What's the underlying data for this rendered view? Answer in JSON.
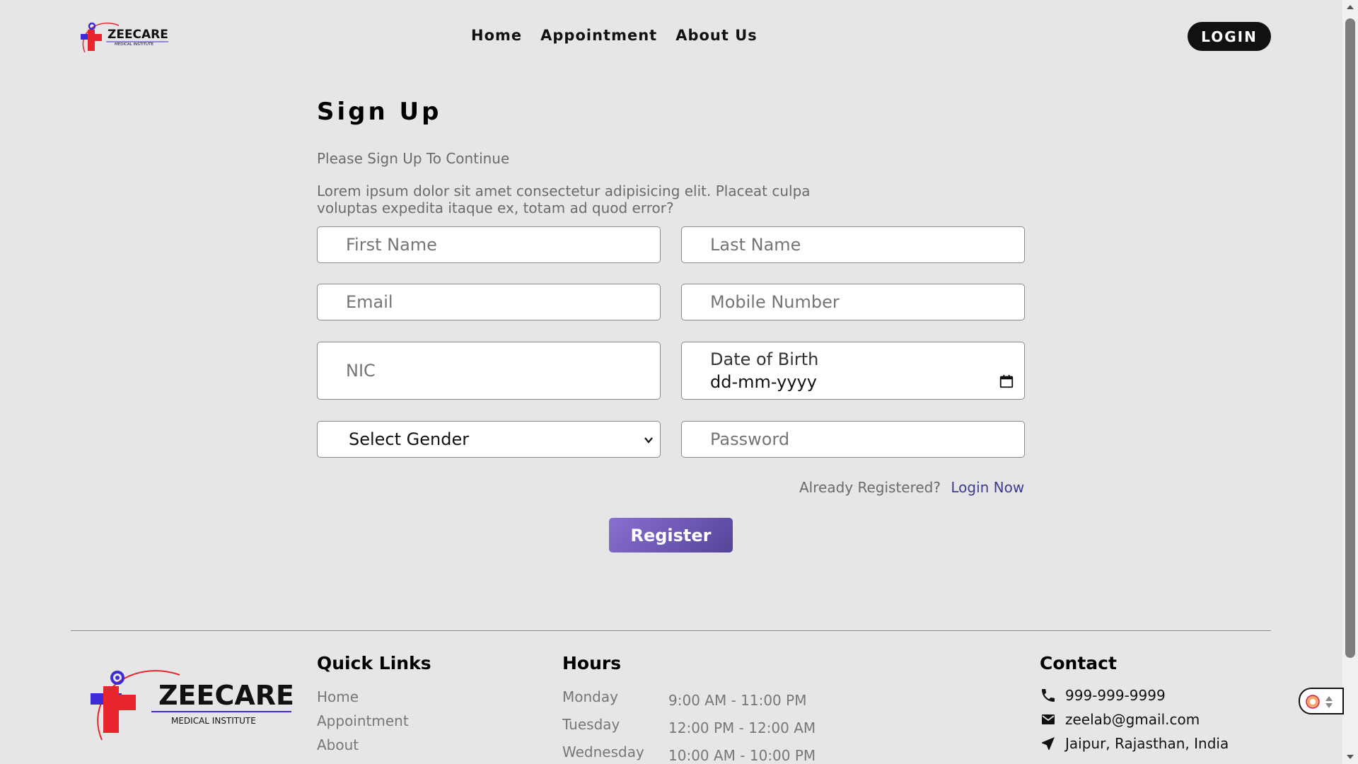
{
  "colors": {
    "background": "#e6e6e6",
    "accent_purple": "#6c58b8",
    "brand_red": "#e8242c",
    "brand_blue": "#3d2bd6",
    "login_bg": "#111111",
    "link_blue": "#3b3b8f"
  },
  "brand": {
    "name": "ZEECARE",
    "tagline": "MEDICAL INSTITUTE"
  },
  "nav": {
    "links": [
      {
        "label": "Home"
      },
      {
        "label": "Appointment"
      },
      {
        "label": "About Us"
      }
    ],
    "login_label": "LOGIN"
  },
  "form": {
    "title": "Sign Up",
    "subtitle": "Please Sign Up To Continue",
    "description": "Lorem ipsum dolor sit amet consectetur adipisicing elit. Placeat culpa voluptas expedita itaque ex, totam ad quod error?",
    "fields": {
      "first_name": {
        "placeholder": "First Name",
        "value": ""
      },
      "last_name": {
        "placeholder": "Last Name",
        "value": ""
      },
      "email": {
        "placeholder": "Email",
        "value": ""
      },
      "mobile": {
        "placeholder": "Mobile Number",
        "value": ""
      },
      "nic": {
        "placeholder": "NIC",
        "value": ""
      },
      "dob": {
        "label": "Date of Birth",
        "placeholder": "dd-mm-yyyy",
        "icon": "calendar-icon"
      },
      "gender": {
        "selected": "Select Gender",
        "icon": "chevron-down-icon"
      },
      "password": {
        "placeholder": "Password",
        "value": ""
      }
    },
    "already_text": "Already Registered?",
    "login_now": "Login Now",
    "register_label": "Register"
  },
  "footer": {
    "quick_links_title": "Quick Links",
    "quick_links": [
      "Home",
      "Appointment",
      "About"
    ],
    "hours_title": "Hours",
    "hours": [
      {
        "day": "Monday",
        "time": "9:00 AM - 11:00 PM"
      },
      {
        "day": "Tuesday",
        "time": "12:00 PM - 12:00 AM"
      },
      {
        "day": "Wednesday",
        "time": "10:00 AM - 10:00 PM"
      }
    ],
    "contact_title": "Contact",
    "contact": {
      "phone": {
        "icon": "phone-icon",
        "text": "999-999-9999"
      },
      "email": {
        "icon": "mail-icon",
        "text": "zeelab@gmail.com"
      },
      "address": {
        "icon": "location-arrow-icon",
        "text": "Jaipur, Rajasthan, India"
      }
    }
  }
}
